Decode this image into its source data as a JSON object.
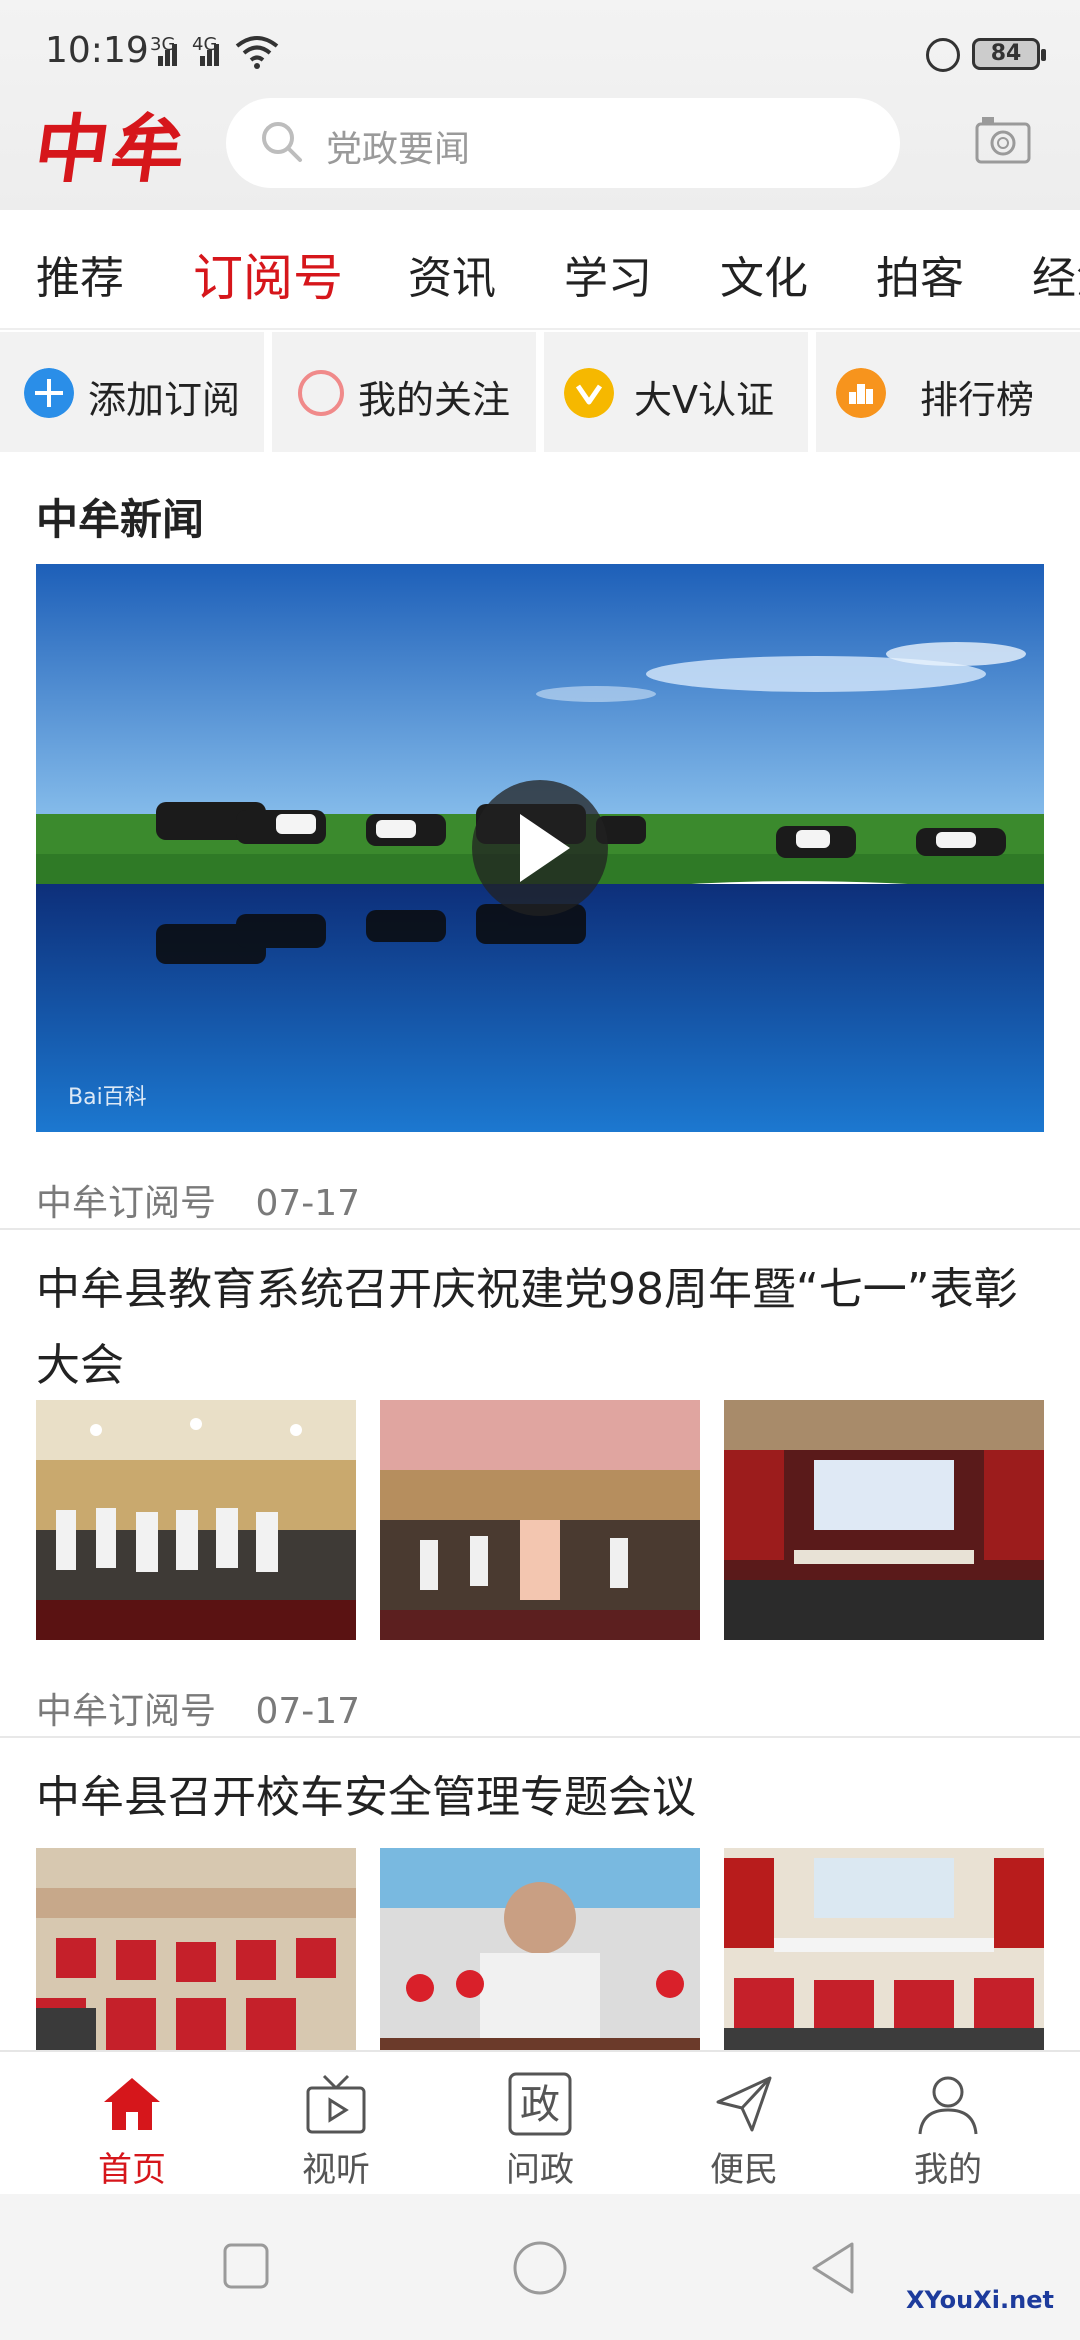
{
  "status_bar": {
    "time": "10:19",
    "network1": "3G",
    "network2": "4G",
    "battery": "84"
  },
  "header": {
    "logo": "中牟",
    "search_placeholder": "党政要闻"
  },
  "tabs": [
    "推荐",
    "订阅号",
    "资讯",
    "学习",
    "文化",
    "拍客",
    "经济"
  ],
  "active_tab": "订阅号",
  "actions": [
    {
      "label": "添加订阅",
      "icon": "plus-circle-icon",
      "color": "#2a8ee8"
    },
    {
      "label": "我的关注",
      "icon": "ring-icon",
      "color": "#f08a8a"
    },
    {
      "label": "大V认证",
      "icon": "v-badge-icon",
      "color": "#f6b800"
    },
    {
      "label": "排行榜",
      "icon": "ranking-icon",
      "color": "#f7941d"
    }
  ],
  "feed": {
    "section_title": "中牟新闻",
    "video_watermark": "Bai百科",
    "video_meta": {
      "source": "中牟订阅号",
      "date": "07-17"
    },
    "article1": {
      "title": "中牟县教育系统召开庆祝建党98周年暨“七一”表彰大会",
      "source": "中牟订阅号",
      "date": "07-17"
    },
    "article2": {
      "title": "中牟县召开校车安全管理专题会议"
    }
  },
  "bottom_nav": [
    {
      "label": "首页",
      "icon": "home-icon",
      "active": true
    },
    {
      "label": "视听",
      "icon": "tv-icon",
      "active": false
    },
    {
      "label": "问政",
      "icon": "zheng-icon",
      "glyph": "政",
      "active": false
    },
    {
      "label": "便民",
      "icon": "paper-plane-icon",
      "active": false
    },
    {
      "label": "我的",
      "icon": "user-icon",
      "active": false
    }
  ],
  "watermark": "XYouXi.net",
  "colors": {
    "brand_red": "#d6161b",
    "grey_text": "#7a7a7a"
  }
}
